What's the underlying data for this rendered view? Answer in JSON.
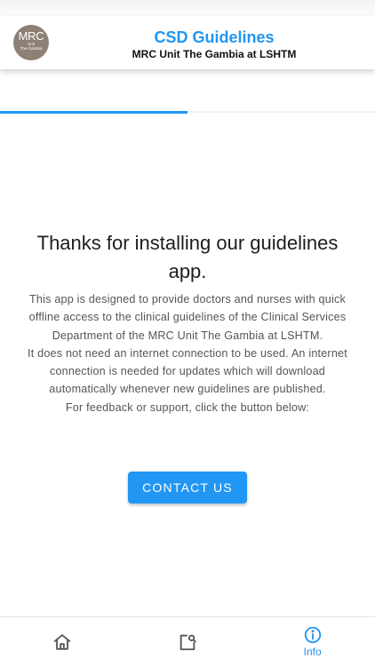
{
  "header": {
    "logo_text": "MRC",
    "logo_subtext": [
      "Unit",
      "The Gambia"
    ],
    "title": "CSD Guidelines",
    "subtitle": "MRC Unit The Gambia at LSHTM"
  },
  "loading": {
    "progress_fraction": 0.5
  },
  "main": {
    "welcome": "Thanks for installing our guidelines app.",
    "paragraphs": [
      "This app is designed to provide doctors and nurses with quick offline access to the clinical guidelines of the Clinical Services Department of the MRC Unit The Gambia at LSHTM.",
      "It does not need an internet connection to be used. An internet connection is needed for updates which will download automatically whenever new guidelines are published.",
      "For feedback or support, click the button below:"
    ],
    "contact_button": "CONTACT US"
  },
  "bottom_nav": {
    "items": [
      {
        "icon": "home-icon",
        "label": "",
        "active": false
      },
      {
        "icon": "edit-note-icon",
        "label": "",
        "active": false
      },
      {
        "icon": "info-icon",
        "label": "Info",
        "active": true
      }
    ]
  },
  "colors": {
    "accent": "#2196f3",
    "logo_background": "#8d8176",
    "inactive_icon": "#555555"
  }
}
